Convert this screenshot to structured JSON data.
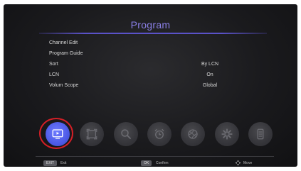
{
  "header": {
    "title": "Program"
  },
  "menu": {
    "items": [
      {
        "label": "Channel Edit",
        "value": ""
      },
      {
        "label": "Program Guide",
        "value": ""
      },
      {
        "label": "Sort",
        "value": "By LCN"
      },
      {
        "label": "LCN",
        "value": "On"
      },
      {
        "label": "Volum Scope",
        "value": "Global"
      }
    ]
  },
  "icon_bar": {
    "items": [
      {
        "icon": "tv-program-icon",
        "active": true
      },
      {
        "icon": "picture-icon",
        "active": false
      },
      {
        "icon": "search-icon",
        "active": false
      },
      {
        "icon": "alarm-clock-icon",
        "active": false
      },
      {
        "icon": "globe-icon",
        "active": false
      },
      {
        "icon": "gear-icon",
        "active": false
      },
      {
        "icon": "storage-icon",
        "active": false
      }
    ]
  },
  "footer": {
    "exit_key": "EXIT",
    "exit_label": "Exit",
    "ok_key": "OK",
    "ok_label": "Confirm",
    "move_label": "Move"
  },
  "colors": {
    "accent": "#8a7fe6",
    "active_icon": "#5563f0",
    "highlight_ring": "#d31f26"
  }
}
